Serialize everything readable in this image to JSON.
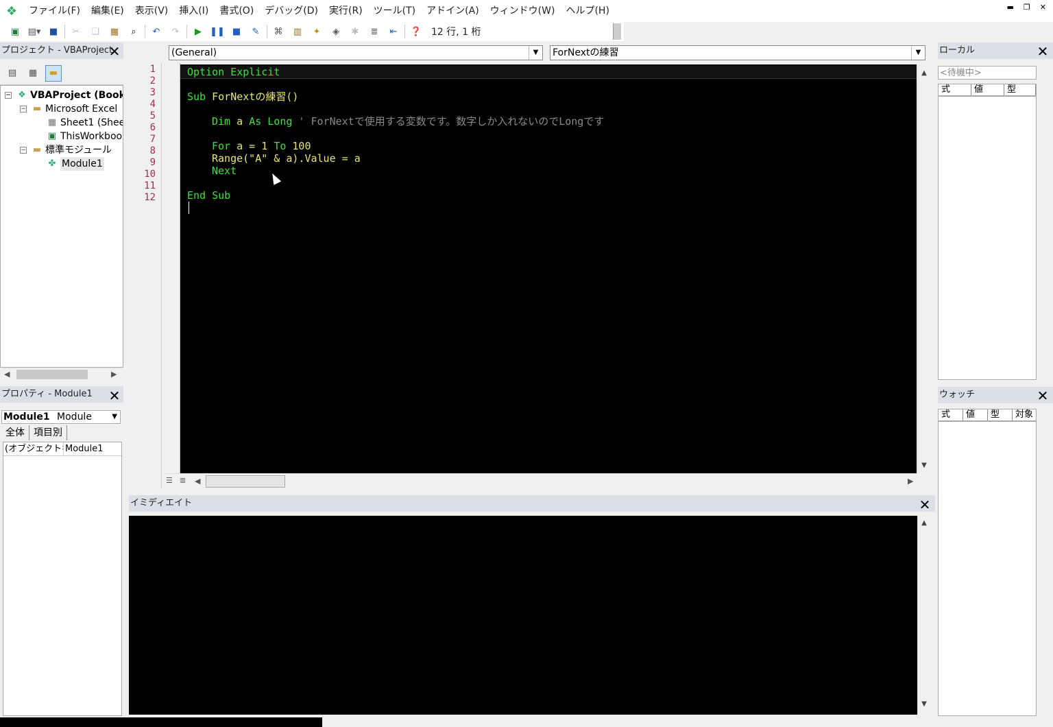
{
  "menu": [
    "ファイル(F)",
    "編集(E)",
    "表示(V)",
    "挿入(I)",
    "書式(O)",
    "デバッグ(D)",
    "実行(R)",
    "ツール(T)",
    "アドイン(A)",
    "ウィンドウ(W)",
    "ヘルプ(H)"
  ],
  "toolbar": {
    "position": "12 行, 1 桁"
  },
  "project": {
    "title": "プロジェクト - VBAProject",
    "tree": [
      "VBAProject (Book",
      "Microsoft Excel",
      "Sheet1 (Shee",
      "ThisWorkboo",
      "標準モジュール",
      "Module1"
    ]
  },
  "properties": {
    "title": "プロパティ - Module1",
    "combo_name": "Module1",
    "combo_type": "Module",
    "tab_all": "全体",
    "tab_category": "項目別",
    "row_name": "(オブジェクト名)",
    "row_value": "Module1"
  },
  "editor": {
    "object_combo": "(General)",
    "proc_combo": "ForNextの練習",
    "line_numbers": [
      "1",
      "2",
      "3",
      "4",
      "5",
      "6",
      "7",
      "8",
      "9",
      "10",
      "11",
      "12"
    ],
    "code": {
      "l1": "Option Explicit",
      "l3_kw": "Sub ",
      "l3_tx": "ForNextの練習()",
      "l5_kw1": "Dim",
      "l5_tx1": " a ",
      "l5_kw2": "As Long",
      "l5_cm": " ' ForNextで使用する変数です。数字しか入れないのでLongです",
      "l7_kw1": "For",
      "l7_tx1": " a = 1 ",
      "l7_kw2": "To",
      "l7_tx2": " 100",
      "l8_tx": "Range(\"A\" & a).Value = a",
      "l9_kw": "Next",
      "l11_kw": "End Sub"
    }
  },
  "immediate": {
    "title": "イミディエイト"
  },
  "locals": {
    "title": "ローカル",
    "status": "<待機中>",
    "col_expr": "式",
    "col_value": "値",
    "col_type": "型"
  },
  "watch": {
    "title": "ウォッチ",
    "col_expr": "式",
    "col_value": "値",
    "col_type": "型",
    "col_context": "対象"
  }
}
